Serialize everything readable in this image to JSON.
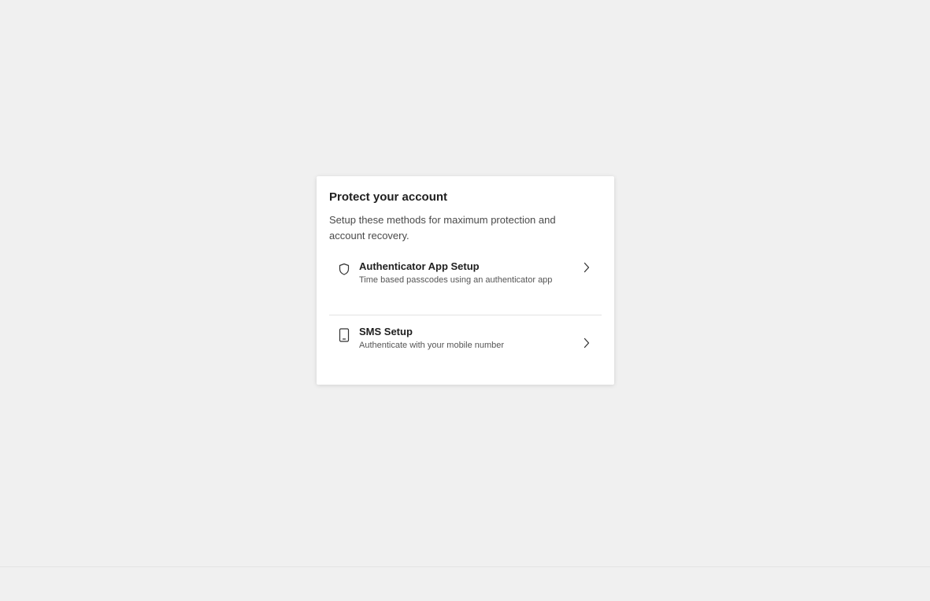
{
  "card": {
    "title": "Protect your account",
    "description": "Setup these methods for maximum protection and account recovery."
  },
  "methods": [
    {
      "name": "Authenticator App Setup",
      "subtitle": "Time based passcodes using an authenticator app",
      "icon": "shield-icon"
    },
    {
      "name": "SMS Setup",
      "subtitle": "Authenticate with your mobile number",
      "icon": "mobile-phone-icon"
    }
  ],
  "colors": {
    "background": "#f0f0f0",
    "card": "#ffffff",
    "text": "#1f1f1f",
    "divider": "#e2e2e2"
  }
}
